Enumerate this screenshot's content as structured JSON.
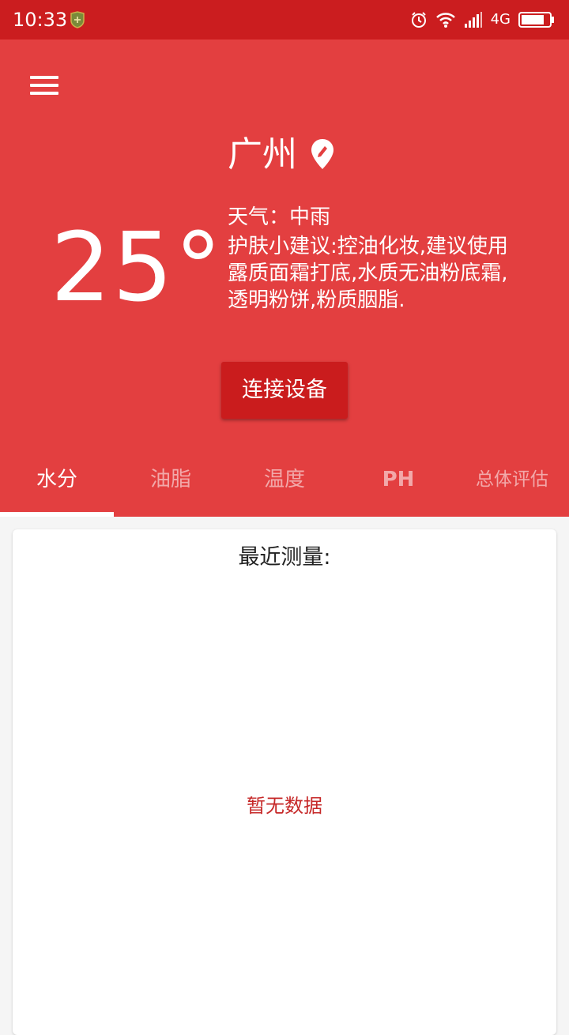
{
  "status_bar": {
    "time": "10:33",
    "network": "4G",
    "icons": [
      "shield-icon",
      "alarm-icon",
      "wifi-icon",
      "signal-icon",
      "battery-icon"
    ]
  },
  "header": {
    "menu_icon": "menu-icon",
    "city": "广州",
    "location_icon": "map-pin-edit-icon",
    "temperature": "25°",
    "weather": "天气：中雨",
    "advice": "护肤小建议:控油化妆,建议使用露质面霜打底,水质无油粉底霜,透明粉饼,粉质胭脂.",
    "connect_button": "连接设备"
  },
  "tabs": [
    {
      "label": "水分",
      "active": true
    },
    {
      "label": "油脂",
      "active": false
    },
    {
      "label": "温度",
      "active": false
    },
    {
      "label": "PH",
      "active": false
    },
    {
      "label": "总体评估",
      "active": false
    }
  ],
  "card": {
    "title": "最近测量:",
    "empty_text": "暂无数据"
  },
  "colors": {
    "status_bar": "#cb1d1f",
    "header": "#e33f40",
    "button": "#ca1c1d",
    "empty_text": "#c62828"
  }
}
